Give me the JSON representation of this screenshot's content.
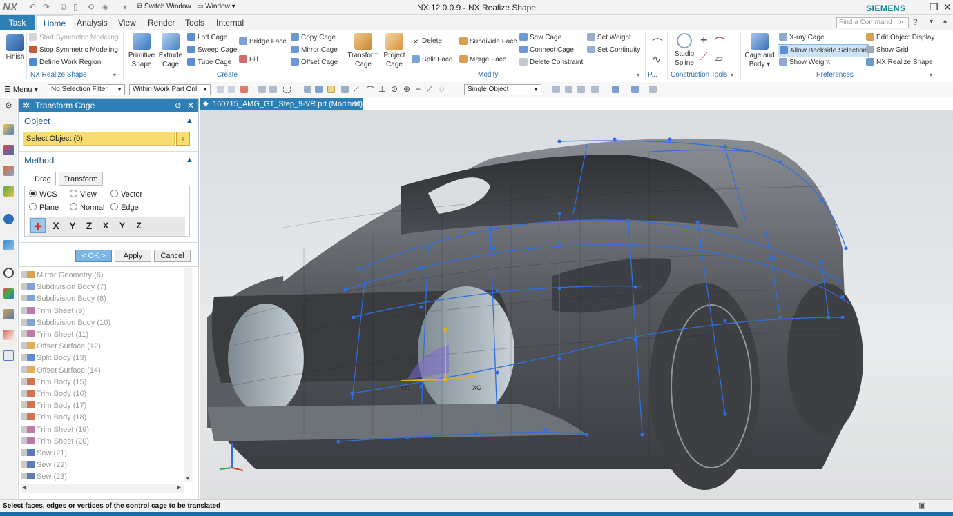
{
  "window": {
    "title": "NX 12.0.0.9 - NX Realize Shape",
    "app_logo": "NX",
    "brand": "SIEMENS",
    "switch_window": "Switch Window",
    "window_menu": "Window"
  },
  "menu": {
    "tabs": [
      "Task",
      "Home",
      "Analysis",
      "View",
      "Render",
      "Tools",
      "Internal"
    ],
    "active": "Home",
    "find_placeholder": "Find a Command"
  },
  "ribbon": {
    "finish": "Finish",
    "nx_realize": {
      "items": [
        "Start Symmetric Modeling",
        "Stop Symmetric Modeling",
        "Define Work Region"
      ],
      "label": "NX Realize Shape"
    },
    "create": {
      "primitive": "Primitive Shape",
      "extrude": "Extrude Cage",
      "items": [
        "Loft Cage",
        "Sweep Cage",
        "Tube Cage",
        "Bridge Face",
        "Fill",
        "Copy Cage",
        "Mirror Cage",
        "Offset Cage"
      ],
      "label": "Create"
    },
    "modify": {
      "transform": "Transform Cage",
      "project": "Project Cage",
      "items": [
        "Delete",
        "Split Face",
        "Subdivide Face",
        "Merge Face",
        "Sew Cage",
        "Connect Cage",
        "Delete Constraint",
        "Set Weight",
        "Set Continuity"
      ],
      "label": "Modify"
    },
    "p_label": "P...",
    "construction": {
      "studio_spline": "Studio Spline",
      "label": "Construction Tools"
    },
    "preferences": {
      "cage_and_body": "Cage and Body",
      "items": [
        "X-ray Cage",
        "Allow Backside Selection",
        "Show Weight",
        "Edit Object Display",
        "Show Grid",
        "NX Realize Shape"
      ],
      "label": "Preferences"
    }
  },
  "toolbar2": {
    "menu": "Menu",
    "filter": "No Selection Filter",
    "scope": "Within Work Part Onl",
    "select_mode": "Single Object"
  },
  "dialog": {
    "title": "Transform Cage",
    "object_section": "Object",
    "select_object": "Select Object (0)",
    "method_section": "Method",
    "tabs": [
      "Drag",
      "Transform"
    ],
    "radios": [
      {
        "label": "WCS",
        "checked": true
      },
      {
        "label": "View",
        "checked": false
      },
      {
        "label": "Vector",
        "checked": false
      },
      {
        "label": "Plane",
        "checked": false
      },
      {
        "label": "Normal",
        "checked": false
      },
      {
        "label": "Edge",
        "checked": false
      }
    ],
    "axis_buttons": [
      "X",
      "Y",
      "Z",
      "X",
      "Y",
      "Z"
    ],
    "buttons": {
      "ok": "< OK >",
      "apply": "Apply",
      "cancel": "Cancel"
    }
  },
  "tree": [
    "Mirror Geometry (6)",
    "Subdivision Body (7)",
    "Subdivision Body (8)",
    "Trim Sheet (9)",
    "Subdivision Body (10)",
    "Trim Sheet (11)",
    "Offset Surface (12)",
    "Split Body (13)",
    "Offset Surface (14)",
    "Trim Body (15)",
    "Trim Body (16)",
    "Trim Body (17)",
    "Trim Body (18)",
    "Trim Sheet (19)",
    "Trim Sheet (20)",
    "Sew (21)",
    "Sew (22)",
    "Sew (23)"
  ],
  "viewport": {
    "tab": "160715_AMG_GT_Step_9-VR.prt (Modified)",
    "axis_labels": [
      "YC",
      "XC"
    ]
  },
  "status": "Select faces, edges or vertices of the control cage to be translated",
  "colors": {
    "accent": "#2e7fb5",
    "cage": "#2f6fe0",
    "highlight": "#f7dc6f"
  }
}
